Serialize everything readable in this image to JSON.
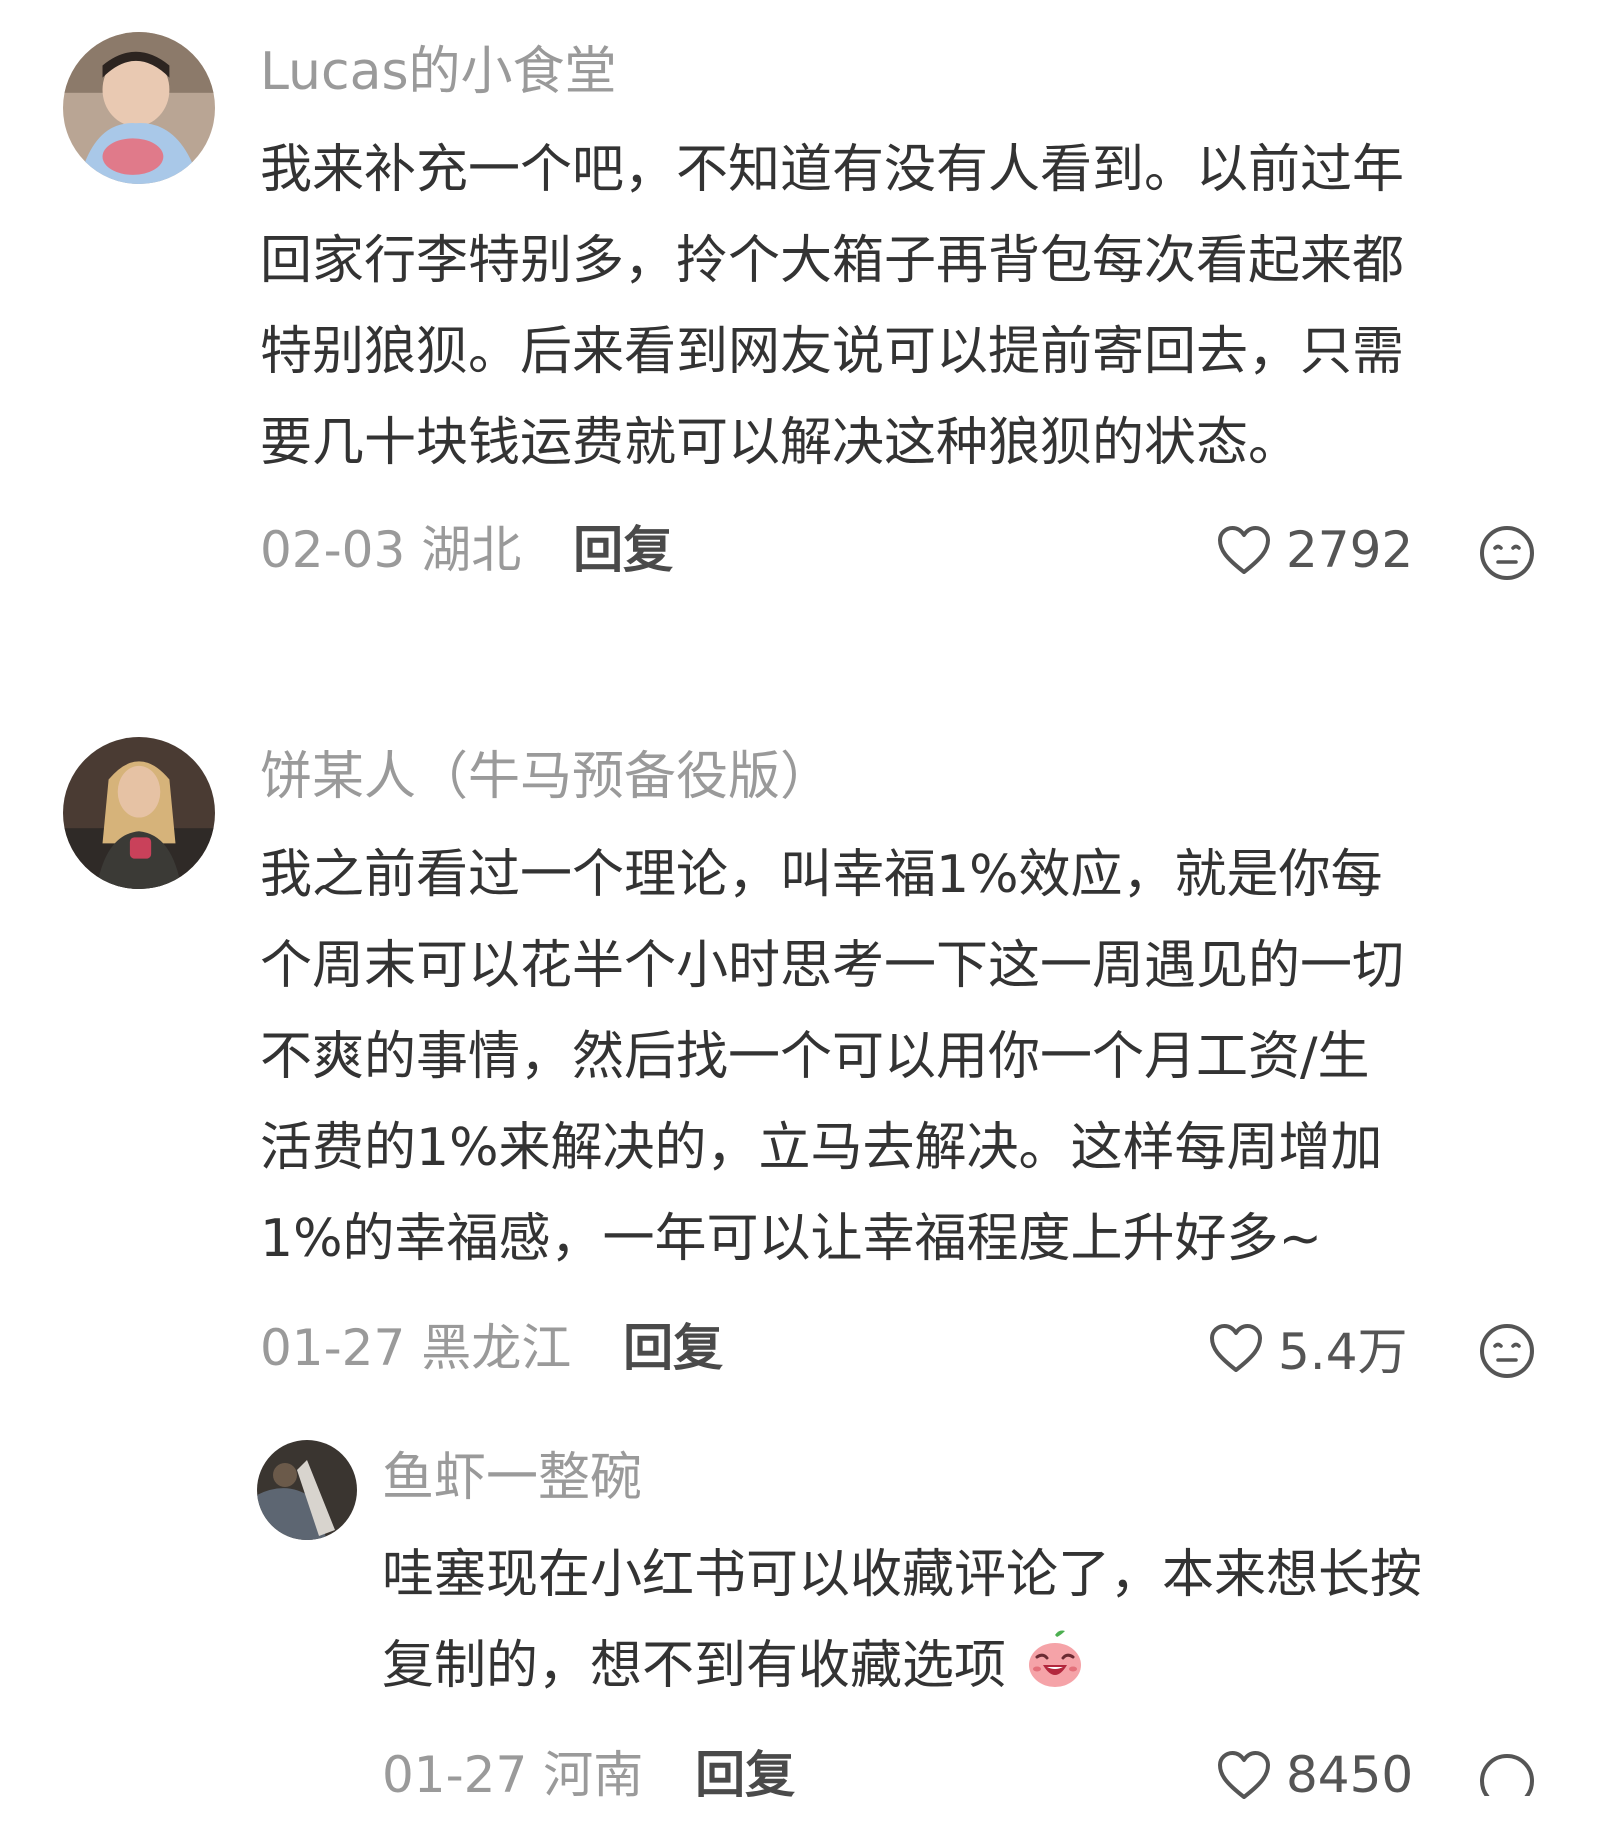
{
  "comments": [
    {
      "username": "Lucas的小食堂",
      "lines": [
        "我来补充一个吧，不知道有没有人看到。以前过年",
        "回家行李特别多，拎个大箱子再背包每次看起来都",
        "特别狼狈。后来看到网友说可以提前寄回去，只需",
        "要几十块钱运费就可以解决这种狼狈的状态。"
      ],
      "date": "02-03",
      "location": "湖北",
      "reply_label": "回复",
      "likes": "2792",
      "like_icon": "heart-outline-icon",
      "dislike_icon": "neutral-face-icon"
    },
    {
      "username": "饼某人（牛马预备役版）",
      "lines": [
        "我之前看过一个理论，叫幸福1%效应，就是你每",
        "个周末可以花半个小时思考一下这一周遇见的一切",
        "不爽的事情，然后找一个可以用你一个月工资/生",
        "活费的1%来解决的，立马去解决。这样每周增加",
        "1%的幸福感，一年可以让幸福程度上升好多~"
      ],
      "date": "01-27",
      "location": "黑龙江",
      "reply_label": "回复",
      "likes": "5.4万",
      "like_icon": "heart-outline-icon",
      "dislike_icon": "neutral-face-icon"
    }
  ],
  "reply": {
    "username": "鱼虾一整碗",
    "lines": [
      "哇塞现在小红书可以收藏评论了，本来想长按",
      "复制的，想不到有收藏选项"
    ],
    "emoji_icon": "laughing-peach-emoji-icon",
    "date": "01-27",
    "location": "河南",
    "reply_label": "回复",
    "likes": "8450",
    "like_icon": "heart-outline-icon"
  },
  "colors": {
    "username": "#9a9a9a",
    "body": "#333333",
    "meta": "#9a9a9a",
    "reply": "#4a4a4a"
  }
}
